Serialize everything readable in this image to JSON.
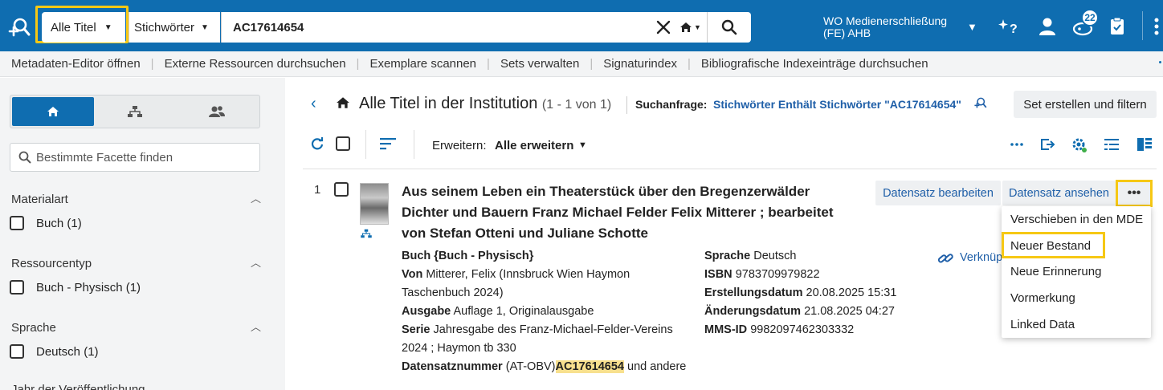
{
  "topbar": {
    "scope_label": "Alle Titel",
    "field_label": "Stichwörter",
    "search_value": "AC17614654",
    "institution_line1": "WO Medienerschließung",
    "institution_line2": "(FE) AHB",
    "tasks_badge": "22"
  },
  "subnav": {
    "items": [
      "Metadaten-Editor öffnen",
      "Externe Ressourcen durchsuchen",
      "Exemplare scannen",
      "Sets verwalten",
      "Signaturindex",
      "Bibliografische Indexeinträge durchsuchen"
    ],
    "separator": "|"
  },
  "facets": {
    "search_placeholder": "Bestimmte Facette finden",
    "groups": [
      {
        "title": "Materialart",
        "option": "Buch",
        "count": "(1)"
      },
      {
        "title": "Ressourcentyp",
        "option": "Buch - Physisch",
        "count": "(1)"
      },
      {
        "title": "Sprache",
        "option": "Deutsch",
        "count": "(1)"
      },
      {
        "title": "Jahr der Veröffentlichung"
      }
    ]
  },
  "results": {
    "title": "Alle Titel in der Institution",
    "count": "(1 - 1 von 1)",
    "query_label": "Suchanfrage:",
    "query_value": "Stichwörter Enthält Stichwörter \"AC17614654\"",
    "set_button": "Set erstellen und filtern",
    "expand_label": "Erweitern:",
    "expand_value": "Alle erweitern"
  },
  "record": {
    "number": "1",
    "title": "Aus seinem Leben ein Theaterstück über den Bregenzerwälder Dichter und Bauern Franz Michael Felder Felix Mitterer ; bearbeitet von Stefan Otteni und Juliane Schotte",
    "type": "Buch {Buch - Physisch}",
    "by_label": "Von",
    "by_value": "Mitterer, Felix (Innsbruck Wien Haymon Taschenbuch 2024)",
    "edition_label": "Ausgabe",
    "edition_value": "Auflage 1, Originalausgabe",
    "series_label": "Serie",
    "series_value": "Jahresgabe des Franz-Michael-Felder-Vereins 2024 ; Haymon tb 330",
    "recno_label": "Datensatznummer",
    "recno_prefix": "(AT-OBV)",
    "recno_value": "AC17614654",
    "recno_suffix": "und andere",
    "language_label": "Sprache",
    "language_value": "Deutsch",
    "isbn_label": "ISBN",
    "isbn_value": "9783709979822",
    "created_label": "Erstellungsdatum",
    "created_value": "20.08.2025 15:31",
    "modified_label": "Änderungsdatum",
    "modified_value": "21.08.2025 04:27",
    "mms_label": "MMS-ID",
    "mms_value": "9982097462303332",
    "link_text": "Verknüp",
    "edit_button": "Datensatz bearbeiten",
    "view_button": "Datensatz ansehen",
    "more_button": "•••"
  },
  "menu": {
    "items": [
      "Verschieben in den MDE",
      "Neuer Bestand",
      "Neue Erinnerung",
      "Vormerkung",
      "Linked Data"
    ]
  },
  "colors": {
    "topbar": "#0f6db0",
    "highlight_border": "#f6c814",
    "link": "#1f5fa8",
    "match_highlight": "#f8e08e"
  }
}
